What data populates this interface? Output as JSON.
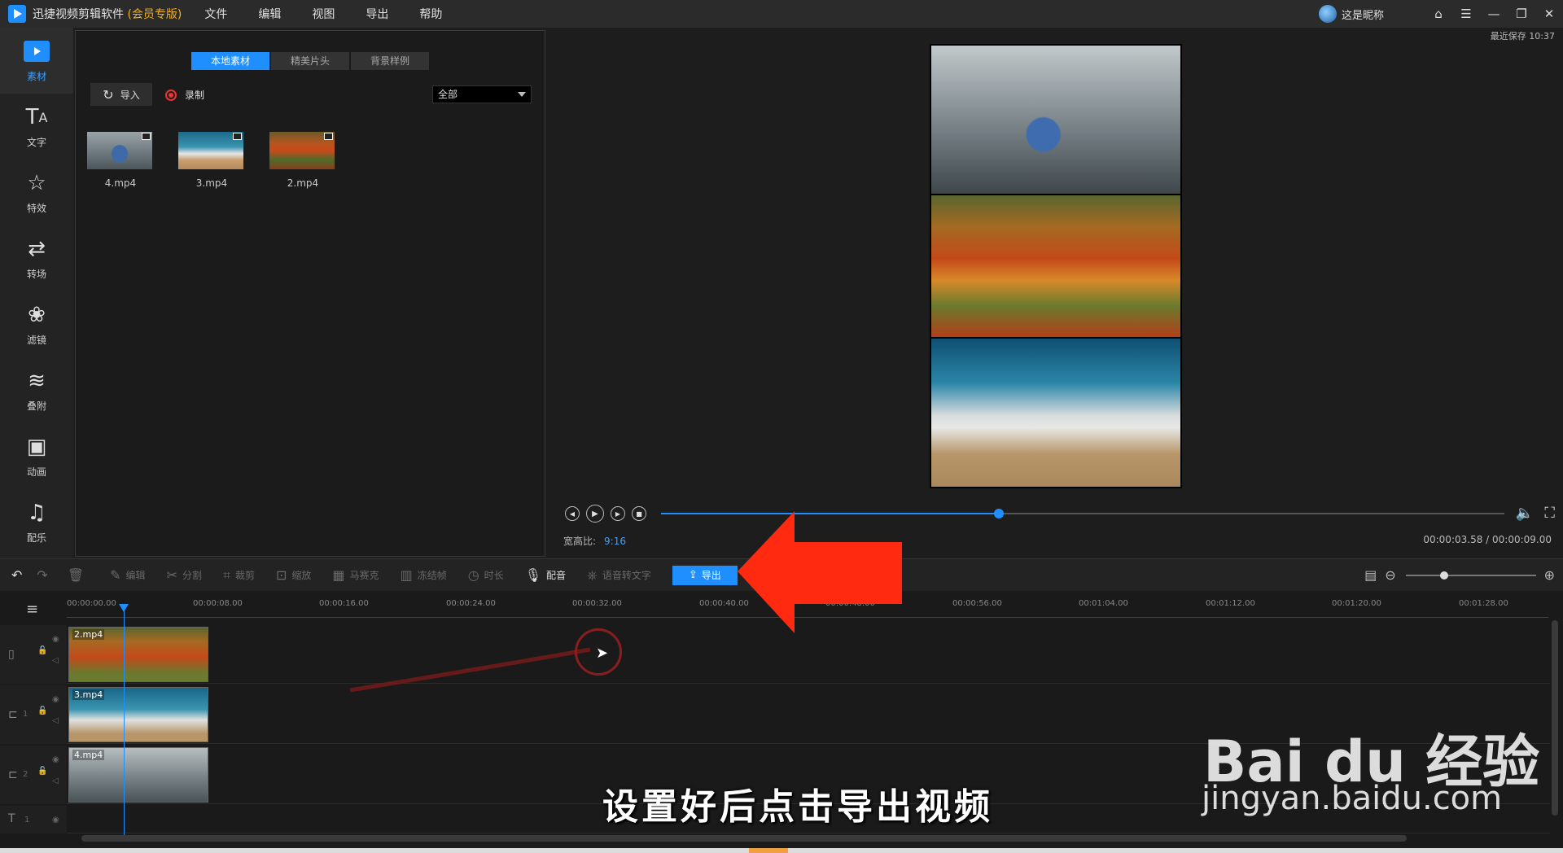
{
  "titlebar": {
    "app_name": "迅捷视频剪辑软件",
    "edition": "(会员专版)",
    "menu": [
      "文件",
      "编辑",
      "视图",
      "导出",
      "帮助"
    ],
    "nickname": "这是昵称",
    "buttons": {
      "home": "⌂",
      "menu": "☰",
      "minimize": "—",
      "restore": "❐",
      "close": "✕"
    }
  },
  "sidebar": {
    "items": [
      {
        "label": "素材",
        "icon": "media-icon"
      },
      {
        "label": "文字",
        "icon": "text-icon"
      },
      {
        "label": "特效",
        "icon": "effects-icon"
      },
      {
        "label": "转场",
        "icon": "transition-icon"
      },
      {
        "label": "滤镜",
        "icon": "filter-icon"
      },
      {
        "label": "叠附",
        "icon": "overlay-icon"
      },
      {
        "label": "动画",
        "icon": "animation-icon"
      },
      {
        "label": "配乐",
        "icon": "music-icon"
      }
    ]
  },
  "material": {
    "tabs": [
      "本地素材",
      "精美片头",
      "背景样例"
    ],
    "import_label": "导入",
    "record_label": "录制",
    "filter_value": "全部",
    "files": [
      "4.mp4",
      "3.mp4",
      "2.mp4"
    ]
  },
  "preview": {
    "last_saved": "最近保存 10:37",
    "ratio_label": "宽高比:",
    "ratio_value": "9:16",
    "timecode": "00:00:03.58 / 00:00:09.00",
    "progress": 0.401
  },
  "toolbar": {
    "edit": "编辑",
    "split": "分割",
    "crop": "裁剪",
    "zoom": "缩放",
    "mosaic": "马赛克",
    "freeze": "冻结帧",
    "duration": "时长",
    "dub": "配音",
    "speech_to_text": "语音转文字",
    "export": "导出"
  },
  "timeline": {
    "ticks": [
      "00:00:00.00",
      "00:00:08.00",
      "00:00:16.00",
      "00:00:24.00",
      "00:00:32.00",
      "00:00:40.00",
      "00:00:48.00",
      "00:00:56.00",
      "00:01:04.00",
      "00:01:12.00",
      "00:01:20.00",
      "00:01:28.00"
    ],
    "tracks": [
      {
        "clip": "2.mp4"
      },
      {
        "clip": "3.mp4",
        "index": "1"
      },
      {
        "clip": "4.mp4",
        "index": "2"
      }
    ],
    "text_track_index": "1"
  },
  "overlay": {
    "subtitle": "设置好后点击导出视频",
    "watermark_brand": "Bai du 经验",
    "watermark_url": "jingyan.baidu.com"
  },
  "colors": {
    "accent": "#1f8fff",
    "arrow": "#ff2a10",
    "vip": "#f0b020"
  }
}
